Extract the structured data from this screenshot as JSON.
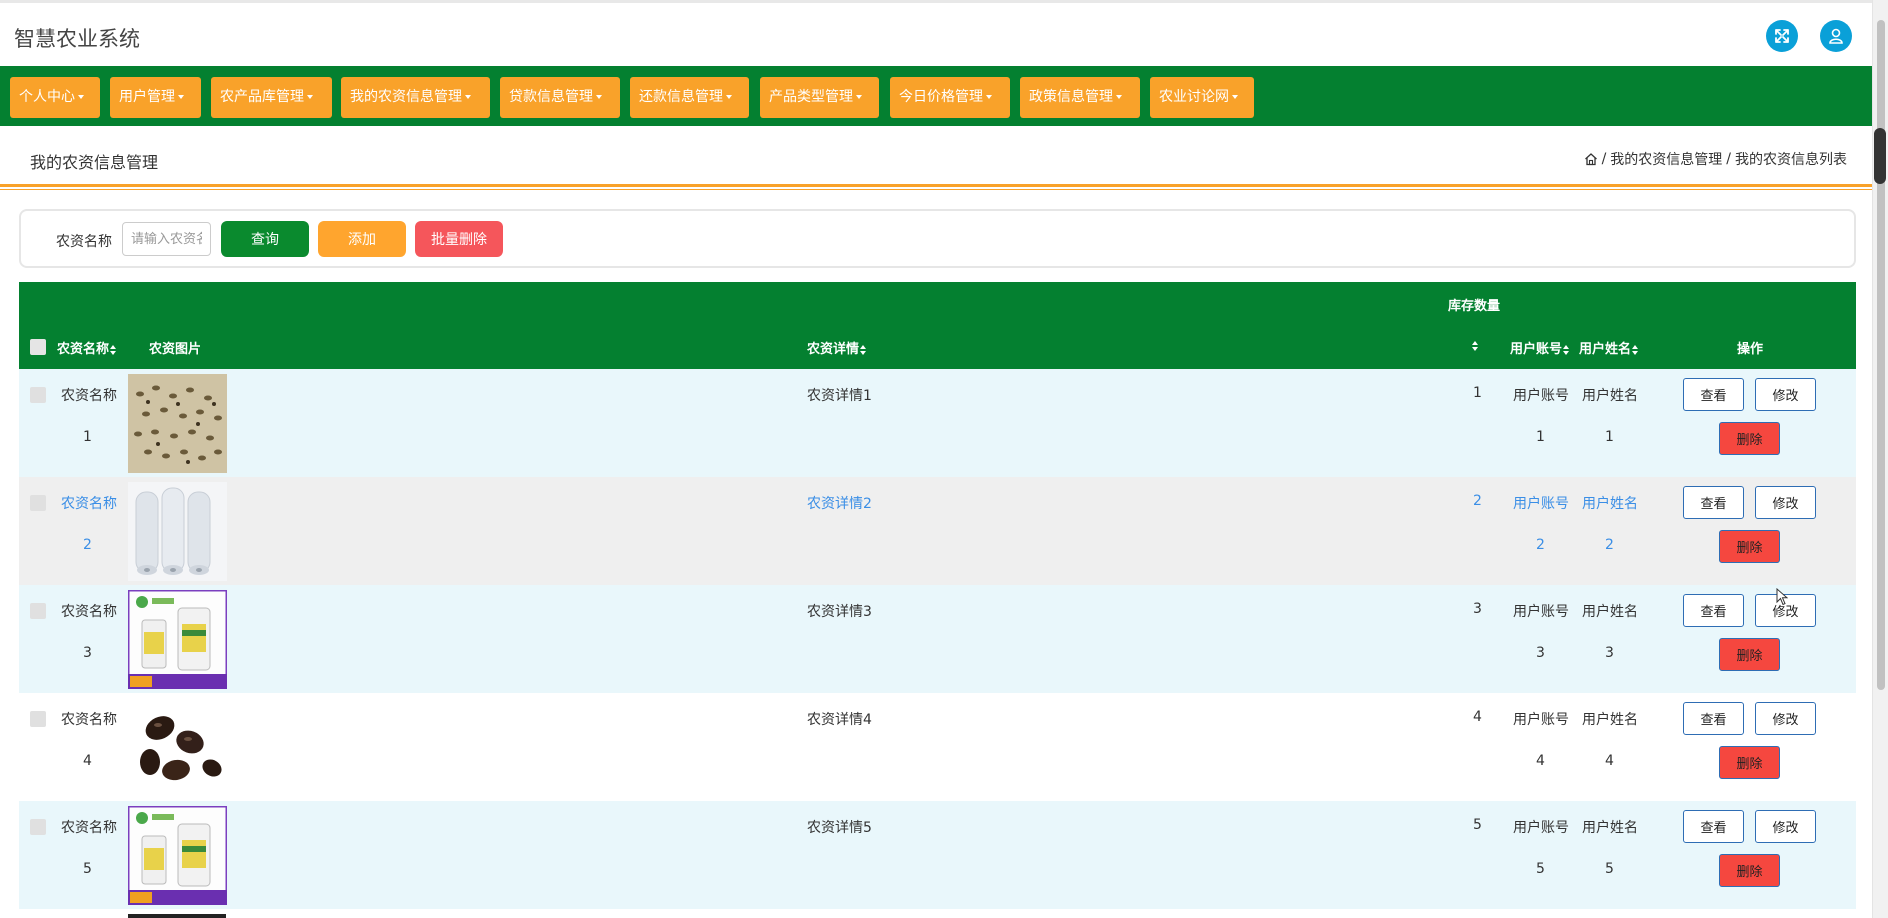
{
  "app": {
    "title": "智慧农业系统"
  },
  "nav": {
    "items": [
      {
        "label": "个人中心"
      },
      {
        "label": "用户管理"
      },
      {
        "label": "农产品库管理"
      },
      {
        "label": "我的农资信息管理"
      },
      {
        "label": "贷款信息管理"
      },
      {
        "label": "还款信息管理"
      },
      {
        "label": "产品类型管理"
      },
      {
        "label": "今日价格管理"
      },
      {
        "label": "政策信息管理"
      },
      {
        "label": "农业讨论网"
      }
    ]
  },
  "page": {
    "title": "我的农资信息管理",
    "breadcrumb": [
      "我的农资信息管理",
      "我的农资信息列表"
    ],
    "breadcrumb_sep": "/"
  },
  "search": {
    "label": "农资名称",
    "placeholder": "请输入农资名称",
    "query_label": "查询",
    "add_label": "添加",
    "batch_delete_label": "批量删除"
  },
  "colors": {
    "nav_green": "#048030",
    "nav_orange": "#f9a22a",
    "query_green": "#0a8a2e",
    "add_orange": "#ffa52e",
    "batch_red": "#f5565b",
    "delete_red": "#f5473f",
    "row_cyan": "#e9f7fb",
    "row_grey": "#efefef",
    "link_blue": "#3a8ee6",
    "icon_blue": "#0aa0d8"
  },
  "table": {
    "headers": {
      "name": "农资名称",
      "image": "农资图片",
      "detail": "农资详情",
      "stock_top": "库存数量",
      "account": "用户账号",
      "username": "用户姓名",
      "actions": "操作"
    },
    "rows": [
      {
        "name": "农资名称",
        "name_no": "1",
        "detail": "农资详情1",
        "stock": "1",
        "account": "用户账号",
        "account_no": "1",
        "username": "用户姓名",
        "username_no": "1",
        "image_icon": "seeds-image-icon"
      },
      {
        "name": "农资名称",
        "name_no": "2",
        "detail": "农资详情2",
        "stock": "2",
        "account": "用户账号",
        "account_no": "2",
        "username": "用户姓名",
        "username_no": "2",
        "image_icon": "film-roll-image-icon"
      },
      {
        "name": "农资名称",
        "name_no": "3",
        "detail": "农资详情3",
        "stock": "3",
        "account": "用户账号",
        "account_no": "3",
        "username": "用户姓名",
        "username_no": "3",
        "image_icon": "pesticide-bottle-image-icon"
      },
      {
        "name": "农资名称",
        "name_no": "4",
        "detail": "农资详情4",
        "stock": "4",
        "account": "用户账号",
        "account_no": "4",
        "username": "用户姓名",
        "username_no": "4",
        "image_icon": "dark-seeds-image-icon"
      },
      {
        "name": "农资名称",
        "name_no": "5",
        "detail": "农资详情5",
        "stock": "5",
        "account": "用户账号",
        "account_no": "5",
        "username": "用户姓名",
        "username_no": "5",
        "image_icon": "pesticide-bottle-image-icon"
      }
    ],
    "view_label": "查看",
    "edit_label": "修改",
    "delete_label": "删除"
  }
}
